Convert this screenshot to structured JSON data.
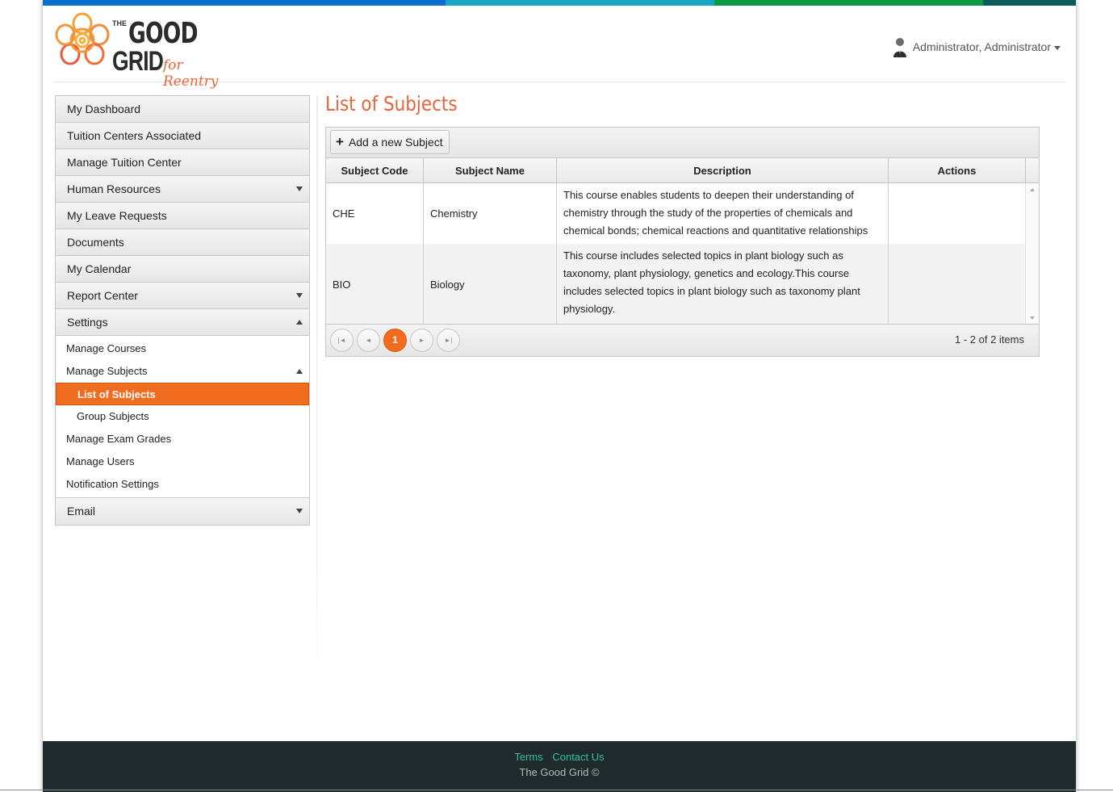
{
  "colors": {
    "top_bar": [
      "#0a6fd0",
      "#17a7c4",
      "#0b9a45",
      "#0b5b5b"
    ],
    "accent": "#f26c20",
    "title": "#e8643a",
    "footer_bg": "#1f2a2d",
    "footer_link": "#2fc0a0"
  },
  "logo": {
    "the": "THE",
    "good": "GOOD",
    "grid": "GRID",
    "tagline": "for Reentry"
  },
  "user": {
    "name": "Administrator, Administrator",
    "icon": "user-avatar-icon"
  },
  "sidebar": {
    "items": [
      {
        "label": "My Dashboard"
      },
      {
        "label": "Tuition Centers Associated"
      },
      {
        "label": "Manage Tuition Center"
      },
      {
        "label": "Human Resources",
        "expandable": true
      },
      {
        "label": "My Leave Requests"
      },
      {
        "label": "Documents"
      },
      {
        "label": "My Calendar"
      },
      {
        "label": "Report Center",
        "expandable": true
      },
      {
        "label": "Settings",
        "expanded": true
      }
    ],
    "settings_sub": {
      "manage_courses": "Manage Courses",
      "manage_subjects": "Manage Subjects",
      "list_of_subjects": "List of Subjects",
      "group_subjects": "Group Subjects",
      "manage_exam_grades": "Manage Exam Grades",
      "manage_users": "Manage Users",
      "notification_settings": "Notification Settings"
    },
    "email": "Email"
  },
  "main": {
    "title": "List of Subjects",
    "add_button": "Add a new Subject",
    "columns": [
      "Subject Code",
      "Subject Name",
      "Description",
      "Actions"
    ],
    "rows": [
      {
        "code": "CHE",
        "name": "Chemistry",
        "description": "This course enables students to deepen their understanding of chemistry through the study of the properties of chemicals and chemical bonds; chemical reactions and quantitative relationships",
        "actions": ""
      },
      {
        "code": "BIO",
        "name": "Biology",
        "description": "This course includes selected topics in plant biology such as taxonomy, plant physiology, genetics and ecology.This course includes selected topics in plant biology such as taxonomy plant physiology.",
        "actions": ""
      }
    ],
    "pager": {
      "current_page": "1",
      "info": "1 - 2 of 2 items"
    }
  },
  "footer": {
    "terms": "Terms",
    "contact": "Contact Us",
    "copyright": "The Good Grid ©"
  }
}
